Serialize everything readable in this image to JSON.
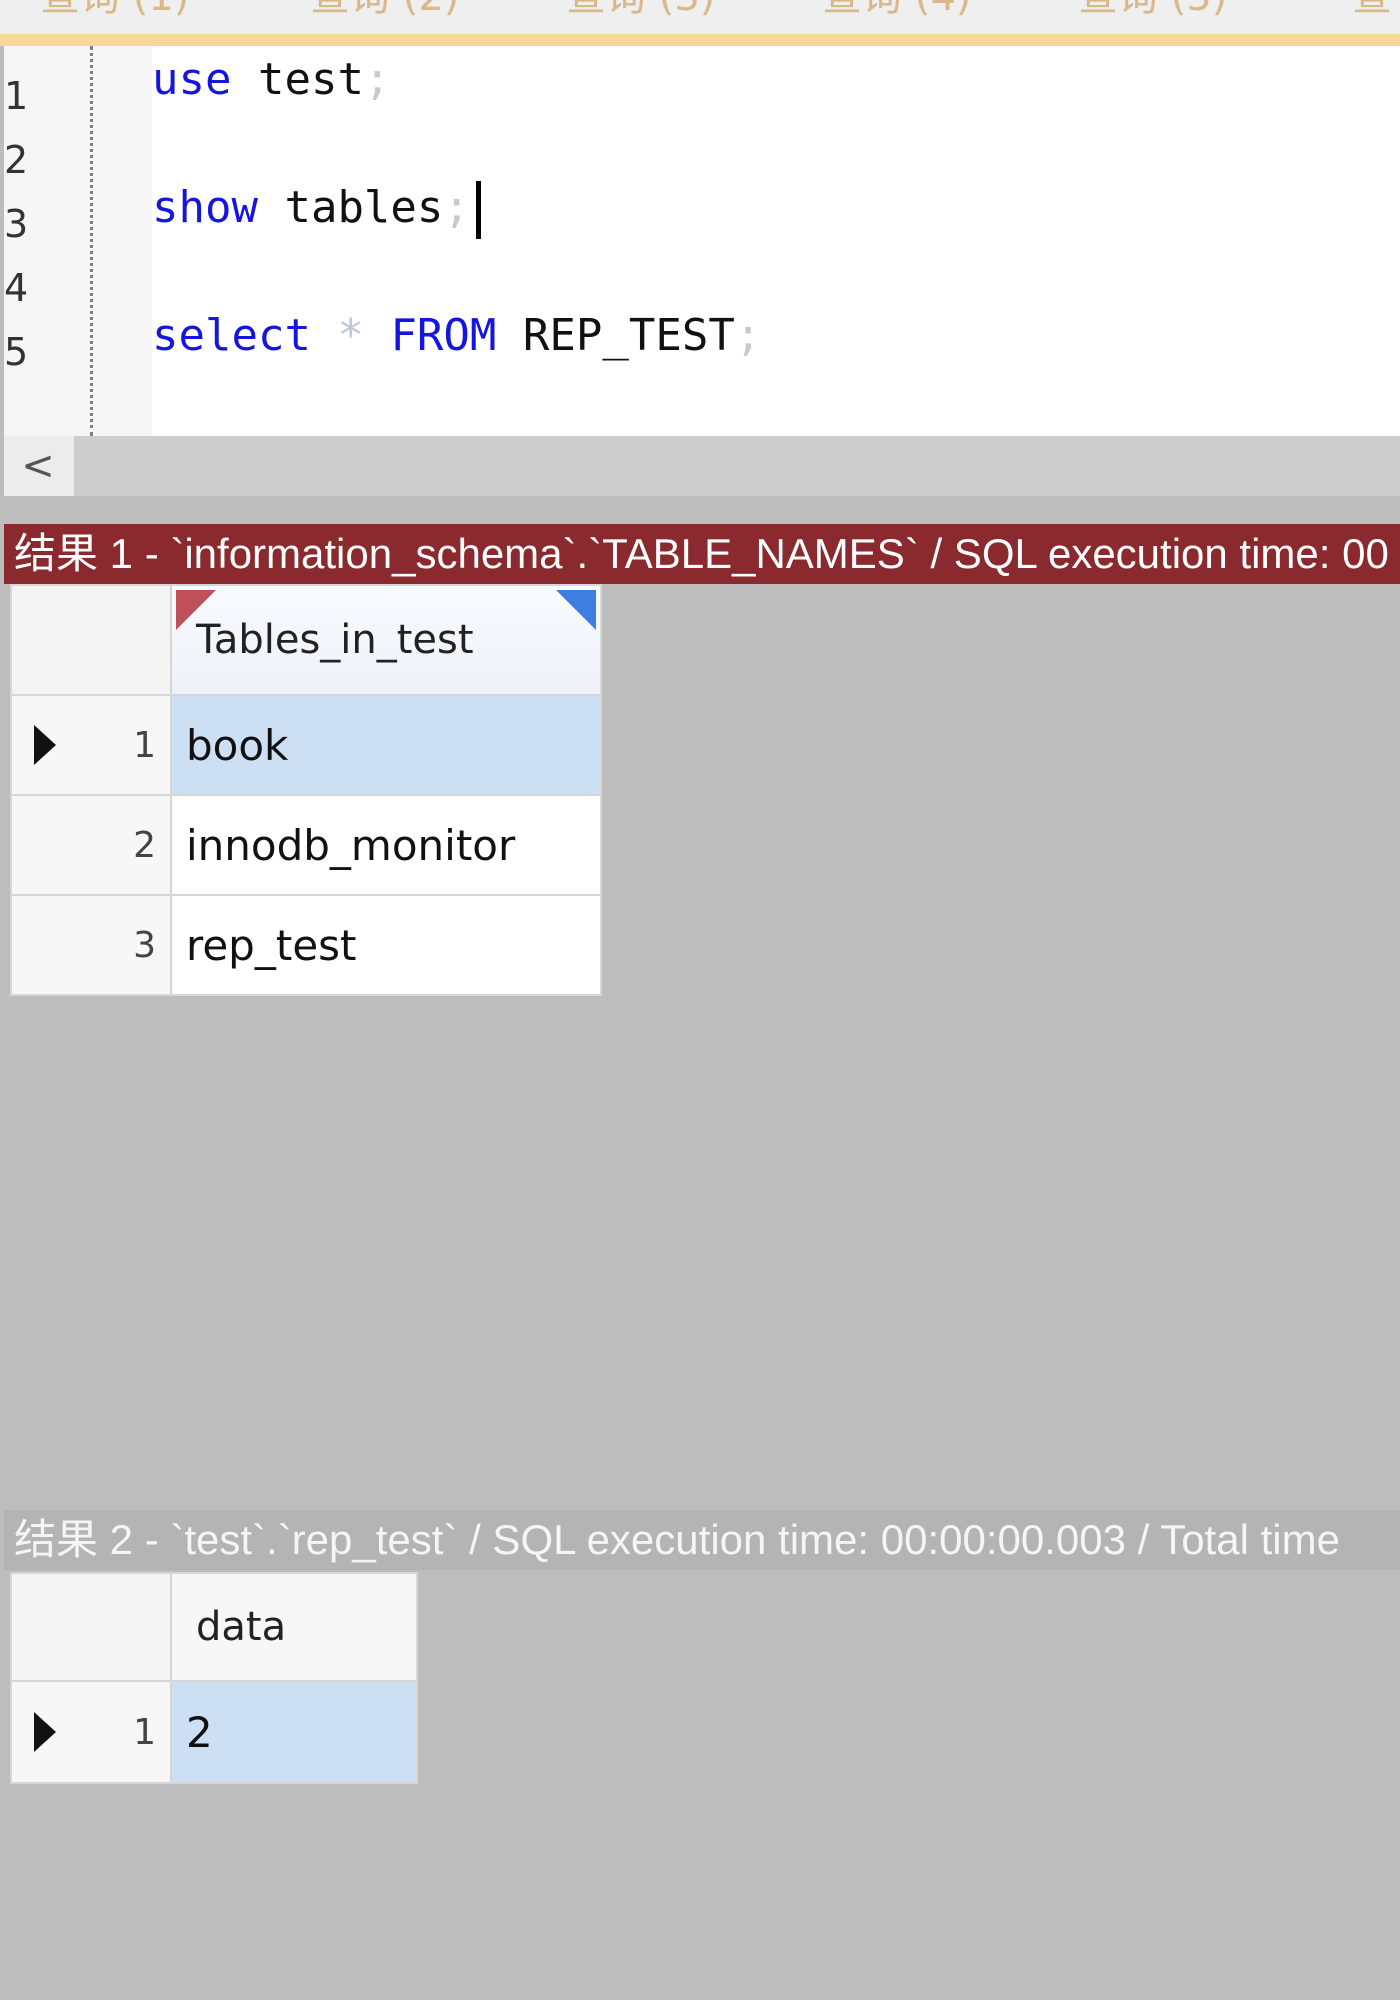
{
  "query_tabs": [
    "查询 (1)",
    "查询 (2)",
    "查询 (3)",
    "查询 (4)",
    "查询 (5)",
    "查"
  ],
  "editor": {
    "line_numbers": [
      "1",
      "2",
      "3",
      "4",
      "5"
    ],
    "line1": {
      "kw": "use",
      "rest": " test",
      "punct": ";"
    },
    "line3": {
      "kw": "show",
      "rest": " tables",
      "punct": ";"
    },
    "line5": {
      "kw1": "select",
      "op": " * ",
      "kw2": "FROM",
      "rest": " REP_TEST",
      "punct": ";"
    }
  },
  "scrollbar": {
    "left_arrow": "<"
  },
  "result1": {
    "header": "结果 1 - `information_schema`.`TABLE_NAMES` / SQL execution time: 00",
    "column": "Tables_in_test",
    "rows": [
      {
        "num": "1",
        "value": "book"
      },
      {
        "num": "2",
        "value": "innodb_monitor"
      },
      {
        "num": "3",
        "value": "rep_test"
      }
    ]
  },
  "result2": {
    "header": "结果 2 - `test`.`rep_test` / SQL execution time: 00:00:00.003 / Total time",
    "column": "data",
    "rows": [
      {
        "num": "1",
        "value": "2"
      }
    ]
  },
  "colors": {
    "keyword": "#1515dd",
    "result1_header": "#8a2a2e",
    "selected_cell": "#cddff3",
    "tab_accent": "#f8d79a"
  }
}
